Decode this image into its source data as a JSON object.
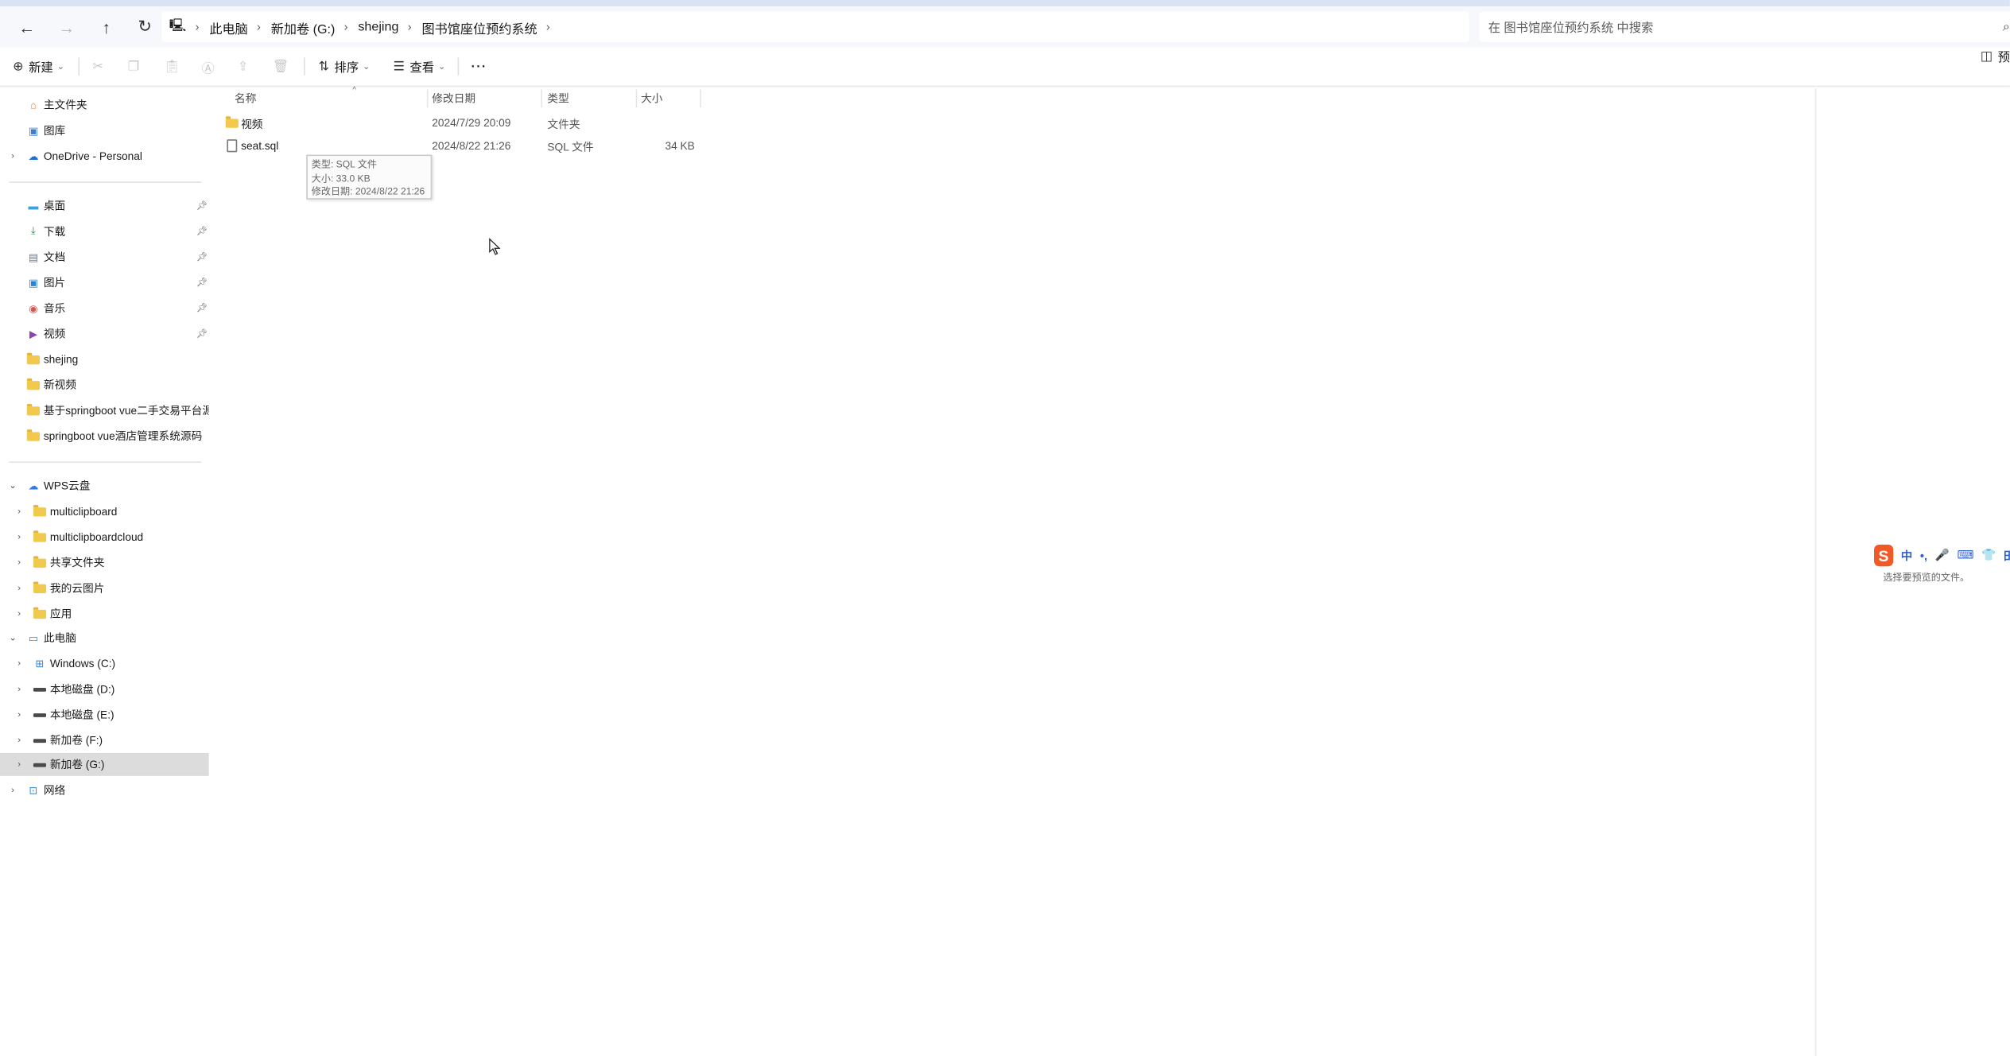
{
  "address": {
    "crumbs": [
      "此电脑",
      "新加卷 (G:)",
      "shejing",
      "图书馆座位预约系统"
    ],
    "search_placeholder": "在 图书馆座位预约系统 中搜索"
  },
  "toolbar": {
    "new_label": "新建",
    "sort_label": "排序",
    "view_label": "查看",
    "more_label": "···",
    "preview_label": "预"
  },
  "sidebar": {
    "quick": [
      {
        "label": "主文件夹",
        "icon": "home-icon"
      },
      {
        "label": "图库",
        "icon": "gallery-icon"
      },
      {
        "label": "OneDrive - Personal",
        "icon": "cloud-icon"
      }
    ],
    "pinned": [
      {
        "label": "桌面",
        "icon": "desktop-icon"
      },
      {
        "label": "下载",
        "icon": "download-icon"
      },
      {
        "label": "文档",
        "icon": "document-icon"
      },
      {
        "label": "图片",
        "icon": "pictures-icon"
      },
      {
        "label": "音乐",
        "icon": "music-icon"
      },
      {
        "label": "视频",
        "icon": "video-icon"
      }
    ],
    "recent_folders": [
      {
        "label": "shejing"
      },
      {
        "label": "新视频"
      },
      {
        "label": "基于springboot vue二手交易平台源码"
      },
      {
        "label": "springboot vue酒店管理系统源码"
      }
    ],
    "wps": {
      "label": "WPS云盘",
      "children": [
        {
          "label": "multiclipboard"
        },
        {
          "label": "multiclipboardcloud"
        },
        {
          "label": "共享文件夹"
        },
        {
          "label": "我的云图片"
        },
        {
          "label": "应用"
        }
      ]
    },
    "this_pc": {
      "label": "此电脑",
      "children": [
        {
          "label": "Windows (C:)"
        },
        {
          "label": "本地磁盘 (D:)"
        },
        {
          "label": "本地磁盘 (E:)"
        },
        {
          "label": "新加卷 (F:)"
        },
        {
          "label": "新加卷 (G:)"
        }
      ]
    },
    "network": {
      "label": "网络"
    }
  },
  "columns": {
    "name": "名称",
    "modified": "修改日期",
    "type": "类型",
    "size": "大小"
  },
  "files": [
    {
      "name": "视频",
      "modified": "2024/7/29 20:09",
      "type": "文件夹",
      "size": ""
    },
    {
      "name": "seat.sql",
      "modified": "2024/8/22 21:26",
      "type": "SQL 文件",
      "size": "34 KB"
    }
  ],
  "tooltip": {
    "type_line": "类型: SQL 文件",
    "size_line": "大小: 33.0 KB",
    "date_line": "修改日期: 2024/8/22 21:26"
  },
  "preview": {
    "empty_text": "选择要预览的文件。"
  },
  "ime": {
    "logo": "S",
    "items": [
      "中",
      "•,",
      "🎤",
      "⌨",
      "👕",
      "田"
    ]
  },
  "colors": {
    "accent": "#2f5fd3",
    "selected_bg": "#dcdcdc",
    "folder": "#f2c94c",
    "ime_brand": "#f05a28"
  }
}
